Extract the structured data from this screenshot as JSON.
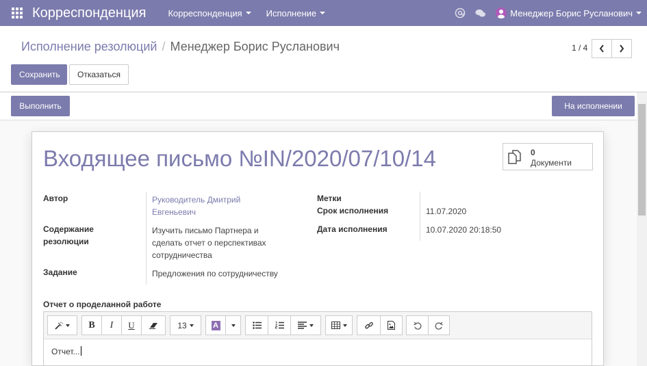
{
  "navbar": {
    "brand": "Корреспонденция",
    "menu": [
      {
        "label": "Корреспонденция"
      },
      {
        "label": "Исполнение"
      }
    ],
    "user": "Менеджер Борис Русланович"
  },
  "breadcrumb": {
    "parent": "Исполнение резолюций",
    "separator": "/",
    "current": "Менеджер Борис Русланович"
  },
  "actions": {
    "save": "Сохранить",
    "discard": "Отказаться"
  },
  "pager": {
    "value": "1 / 4"
  },
  "statusbar": {
    "execute": "Выполнить",
    "state": "На исполнении"
  },
  "record": {
    "title": "Входящее письмо №IN/2020/07/10/14",
    "documents": {
      "count": "0",
      "label": "Документи"
    },
    "fields": {
      "author_label": "Автор",
      "author_line1": "Руководитель Дмитрий",
      "author_line2": "Евгеньевич",
      "content_label_line1": "Содержание",
      "content_label_line2": "резолюции",
      "content_line1": "Изучить письмо Партнера и",
      "content_line2": "сделать отчет о перспективах",
      "content_line3": "сотрудничества",
      "task_label": "Задание",
      "task_value": "Предложения по сотрудничеству",
      "tags_label": "Метки",
      "deadline_label": "Срок исполнения",
      "deadline_value": "11.07.2020",
      "exec_date_label": "Дата исполнения",
      "exec_date_value": "10.07.2020 20:18:50"
    },
    "report_label": "Отчет о проделанной работе",
    "report_text": "Отчет..."
  },
  "editor": {
    "bold": "B",
    "italic": "I",
    "underline": "U",
    "font_size": "13",
    "color_letter": "A"
  },
  "colors": {
    "brand": "#7c7bad",
    "avatar": "#b05bb9"
  }
}
